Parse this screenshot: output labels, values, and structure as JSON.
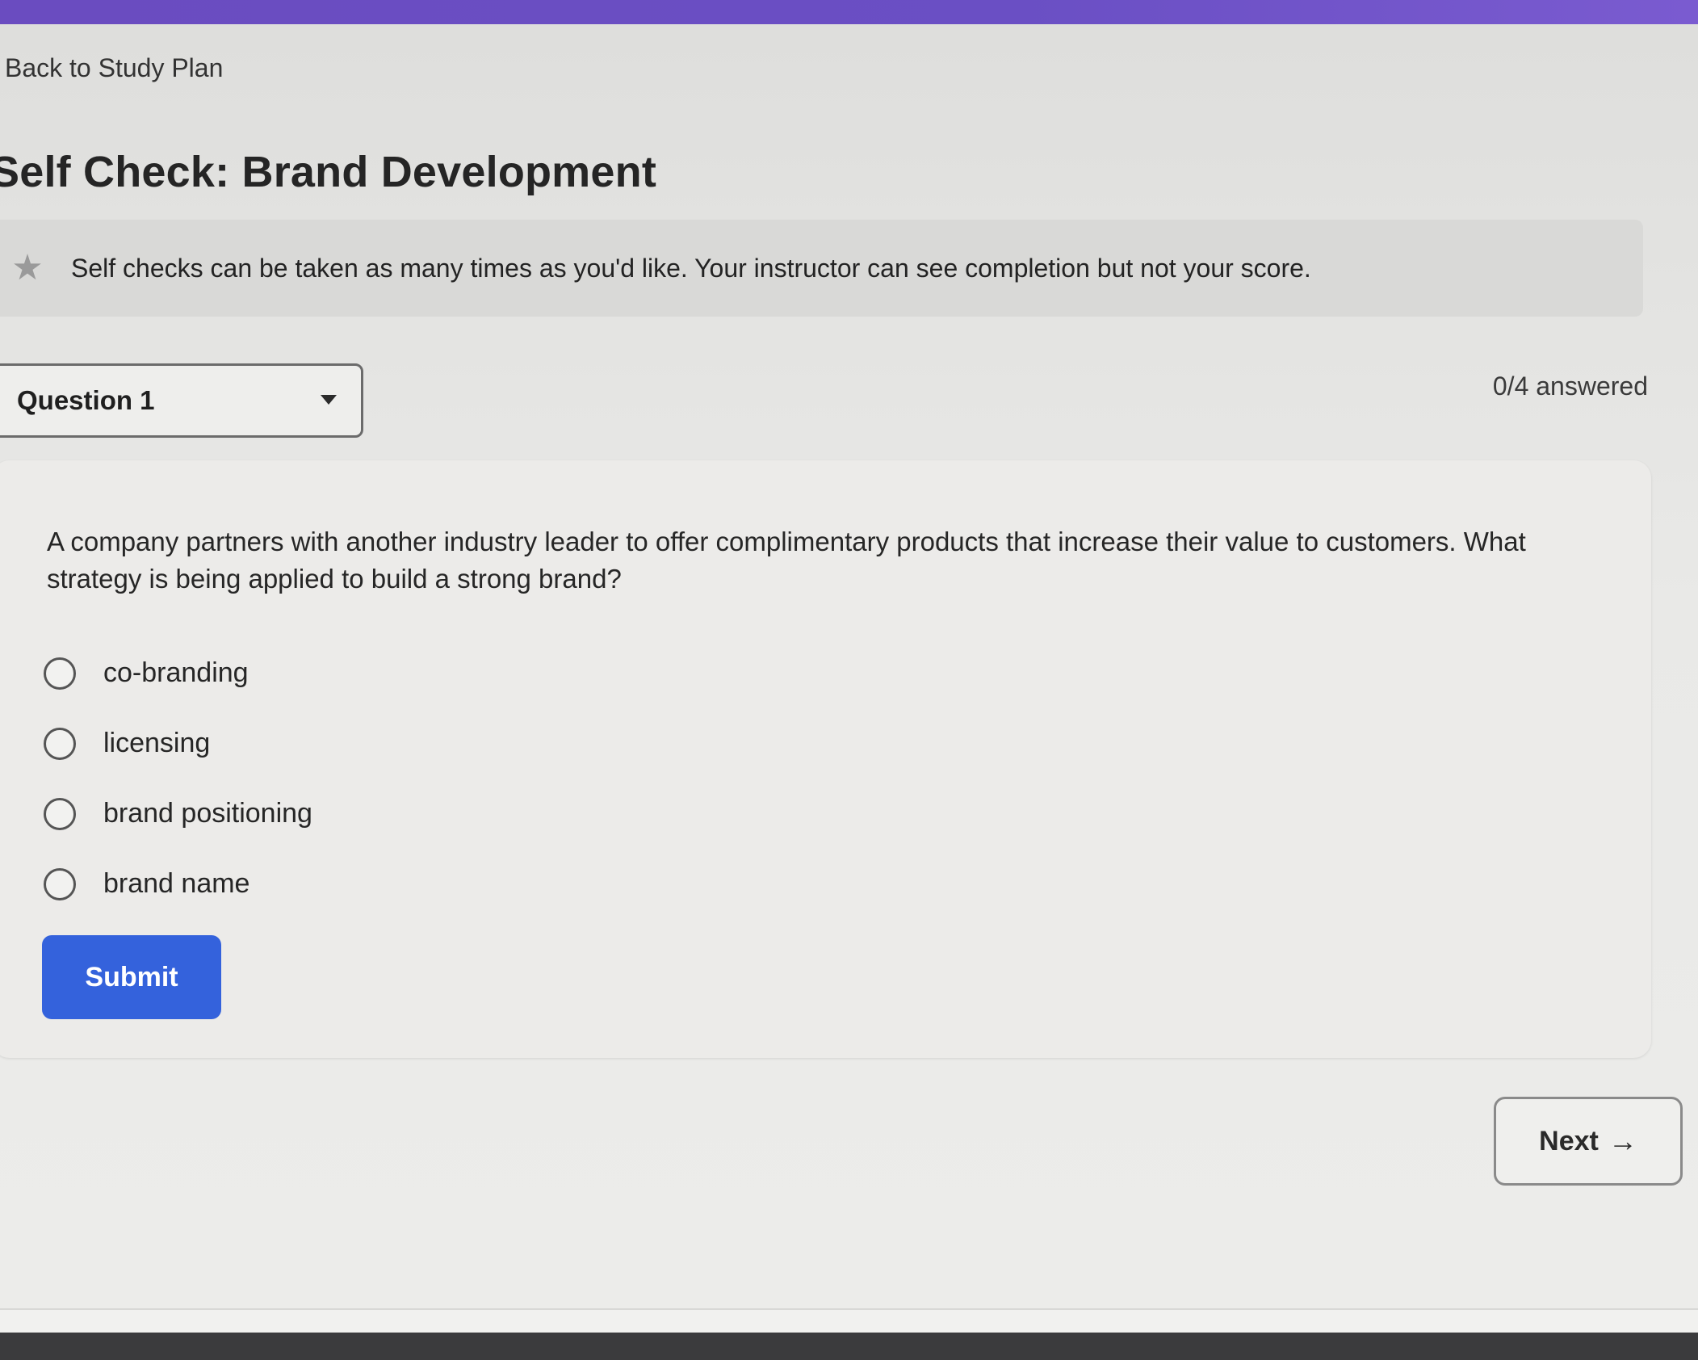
{
  "nav": {
    "back_link": "Back to Study Plan"
  },
  "page": {
    "title": "Self Check: Brand Development"
  },
  "banner": {
    "icon": "star-icon",
    "text": "Self checks can be taken as many times as you'd like. Your instructor can see completion but not your score."
  },
  "question_select": {
    "selected": "Question 1",
    "icon": "caret-down-icon"
  },
  "progress": {
    "answered_text": "0/4 answered"
  },
  "question": {
    "text": "A company partners with another industry leader to offer complimentary products that increase their value to customers. What strategy is being applied to build a strong brand?",
    "options": [
      {
        "label": "co-branding",
        "selected": false
      },
      {
        "label": "licensing",
        "selected": false
      },
      {
        "label": "brand positioning",
        "selected": false
      },
      {
        "label": "brand name",
        "selected": false
      }
    ]
  },
  "actions": {
    "submit_label": "Submit",
    "next_label": "Next",
    "next_icon": "arrow-right-icon"
  },
  "colors": {
    "top_bar": "#6a4cc0",
    "submit_button": "#3462dc",
    "page_background": "#e4e4e2"
  }
}
